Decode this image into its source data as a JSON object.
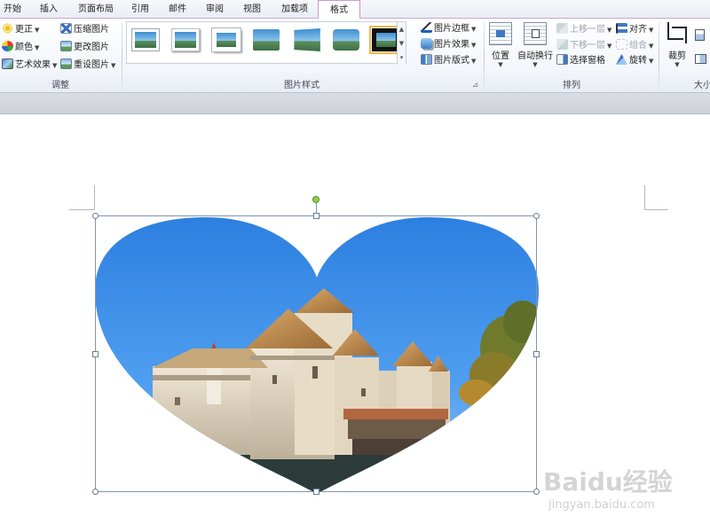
{
  "tabs": [
    {
      "label": "开始",
      "active": false
    },
    {
      "label": "插入",
      "active": false
    },
    {
      "label": "页面布局",
      "active": false
    },
    {
      "label": "引用",
      "active": false
    },
    {
      "label": "邮件",
      "active": false
    },
    {
      "label": "审阅",
      "active": false
    },
    {
      "label": "视图",
      "active": false
    },
    {
      "label": "加载项",
      "active": false
    },
    {
      "label": "格式",
      "active": true
    }
  ],
  "groups": {
    "adjust": {
      "label": "调整",
      "corrections": "更正",
      "color": "颜色",
      "artistic_effects": "艺术效果",
      "compress": "压缩图片",
      "change_picture": "更改图片",
      "reset_picture": "重设图片"
    },
    "picture_styles": {
      "label": "图片样式",
      "border": "图片边框",
      "effects": "图片效果",
      "layout": "图片版式",
      "selected_index": 6
    },
    "arrange": {
      "label": "排列",
      "position": "位置",
      "wrap_text": "自动换行",
      "bring_forward": "上移一层",
      "send_backward": "下移一层",
      "selection_pane": "选择窗格",
      "align": "对齐",
      "group": "组合",
      "rotate": "旋转"
    },
    "size": {
      "label": "大小",
      "crop": "裁剪"
    }
  },
  "colors": {
    "active_tab_border": "#c59bd0",
    "sky": "#3a8fe6",
    "selection_handle": "#6a7f96",
    "rotate_handle": "#8bd14a"
  },
  "watermark": {
    "logo": "Baidu经验",
    "url": "jingyan.baidu.com"
  }
}
